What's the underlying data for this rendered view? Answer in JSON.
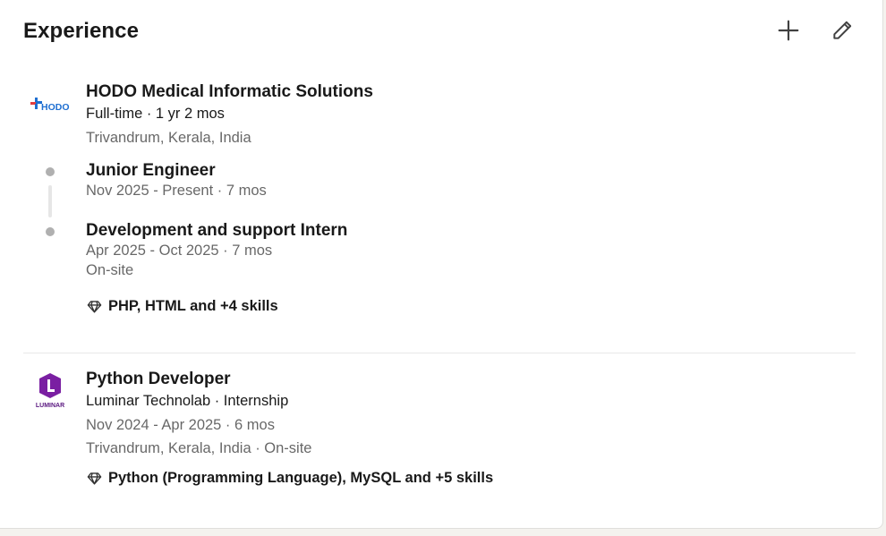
{
  "section": {
    "title": "Experience"
  },
  "actions": {
    "add_icon": "plus-icon",
    "edit_icon": "pencil-icon"
  },
  "experiences": [
    {
      "company": "HODO Medical Informatic Solutions",
      "logo_text": "HODO",
      "employment": "Full-time · 1 yr 2 mos",
      "location": "Trivandrum, Kerala, India",
      "roles": [
        {
          "title": "Junior Engineer",
          "dates": "Nov 2025 - Present · 7 mos"
        },
        {
          "title": "Development and support Intern",
          "dates": "Apr 2025 - Oct 2025 · 7 mos",
          "workplace": "On-site"
        }
      ],
      "skills": "PHP, HTML and +4 skills"
    },
    {
      "title": "Python Developer",
      "logo_text": "LUMINAR",
      "company_line": "Luminar Technolab · Internship",
      "dates": "Nov 2024 - Apr 2025 · 6 mos",
      "location": "Trivandrum, Kerala, India · On-site",
      "skills": "Python (Programming Language), MySQL and +5 skills"
    }
  ],
  "colors": {
    "hodo_blue": "#1f6fd1",
    "hodo_red": "#e33d3d",
    "luminar_purple": "#7a1fa2",
    "timeline_dot": "#b0b0b0"
  }
}
